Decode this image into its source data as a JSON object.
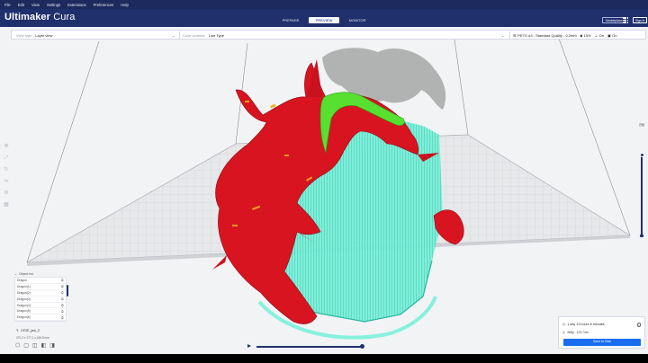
{
  "menu": [
    "File",
    "Edit",
    "View",
    "Settings",
    "Extensions",
    "Preferences",
    "Help"
  ],
  "header": {
    "logo_bold": "Ultimaker",
    "logo_light": " Cura",
    "stages": [
      "PREPARE",
      "PREVIEW",
      "MONITOR"
    ],
    "active_stage": "PREVIEW",
    "marketplace": "Marketplace",
    "signin": "Sign in"
  },
  "settings_bar": {
    "view_type_label": "View type",
    "view_type_value": "Layer view",
    "color_scheme_label": "Color scheme",
    "color_scheme_value": "Line Type",
    "profile": "PETG #3 - Standard Quality - 0.2mm",
    "infill": "15%",
    "support": "On",
    "adhesion": "On"
  },
  "objects": {
    "header": "Object list",
    "items": [
      "Dragon",
      "Dragon(1)",
      "Dragon(2)",
      "Dragon(3)",
      "Dragon(4)",
      "Dragon(5)",
      "Dragon(6)"
    ]
  },
  "model": {
    "name": "CE3E_jaw_3",
    "dims": "270.2 x 177.1 x 166.8 mm"
  },
  "layer_slider": {
    "current_layer": "756"
  },
  "summary": {
    "time": "1 day 13 hours 8 minutes",
    "material": "369g · 123.74m",
    "button": "Save to Disk"
  },
  "colors": {
    "brand_dark": "#20306d",
    "menubar": "#1d2a5d",
    "accent_blue": "#196ef0",
    "model_wall": "#d81421",
    "support": "#74f0d8",
    "infill": "#f0b020",
    "skin": "#58e030"
  }
}
